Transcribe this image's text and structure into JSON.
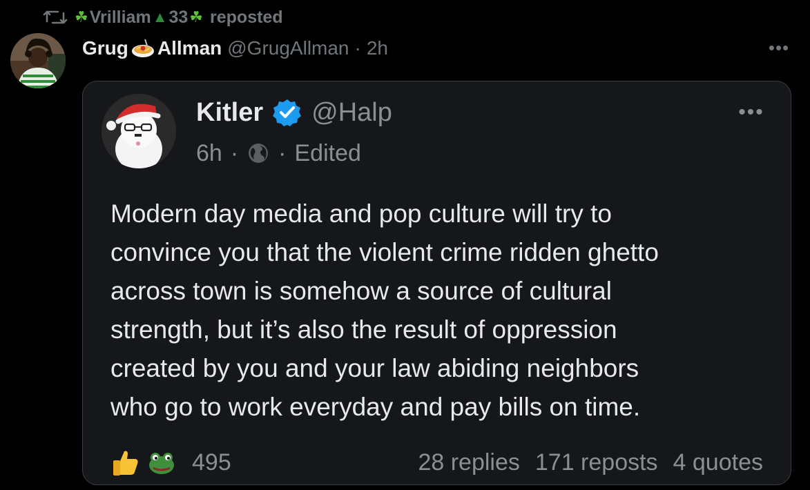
{
  "repost": {
    "reposter_name": "Vrilliam",
    "reposter_number": "33",
    "reposted_label": "reposted"
  },
  "post": {
    "author_first": "Grug",
    "author_last": "Allman",
    "handle": "@GrugAllman",
    "separator": "·",
    "time": "2h",
    "more": "•••"
  },
  "quote": {
    "author_name": "Kitler",
    "handle": "@Halp",
    "time": "6h",
    "separator": "·",
    "edited_label": "Edited",
    "more": "•••",
    "body_lines": [
      "Modern day media and pop culture will try to",
      "convince you that the violent crime ridden ghetto",
      "across town is somehow a source of cultural",
      "strength, but it’s also the result of oppression",
      "created by you and your law abiding neighbors",
      "who go to work everyday and pay bills on time."
    ],
    "like_count": "495",
    "replies": "28 replies",
    "reposts": "171 reposts",
    "quotes": "4 quotes"
  },
  "colors": {
    "background": "#000000",
    "card": "#16171b",
    "muted": "#71767b",
    "verified": "#1d9bf0"
  }
}
